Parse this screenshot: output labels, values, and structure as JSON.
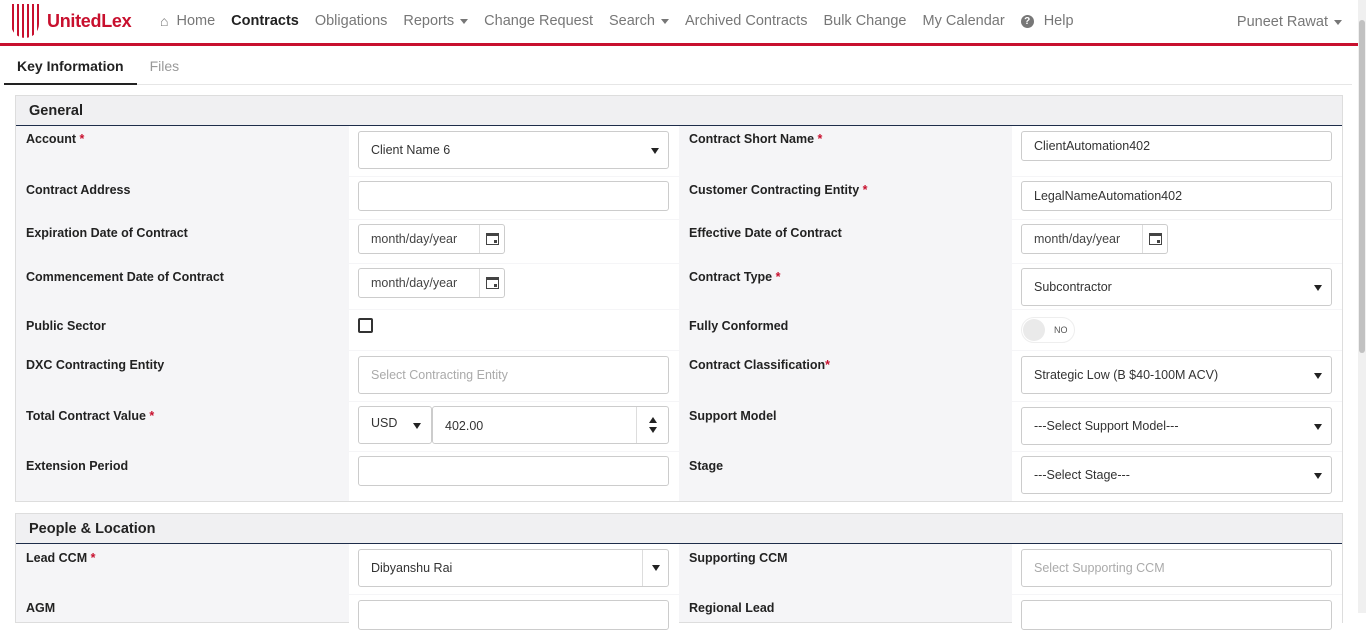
{
  "brand": {
    "name": "UnitedLex",
    "color": "#c8102e"
  },
  "nav": {
    "home": "Home",
    "contracts": "Contracts",
    "obligations": "Obligations",
    "reports": "Reports",
    "change_request": "Change Request",
    "search": "Search",
    "archived": "Archived Contracts",
    "bulk_change": "Bulk Change",
    "calendar": "My Calendar",
    "help": "Help"
  },
  "user": {
    "name": "Puneet Rawat"
  },
  "tabs": {
    "key_information": "Key Information",
    "files": "Files"
  },
  "general": {
    "title": "General",
    "account": {
      "label": "Account",
      "value": "Client Name 6"
    },
    "contract_short_name": {
      "label": "Contract Short Name",
      "value": "ClientAutomation402"
    },
    "contract_address": {
      "label": "Contract Address",
      "value": ""
    },
    "customer_contracting_entity": {
      "label": "Customer Contracting Entity",
      "value": "LegalNameAutomation402"
    },
    "expiration_date": {
      "label": "Expiration Date of Contract",
      "placeholder": "month/day/year"
    },
    "effective_date": {
      "label": "Effective Date of Contract",
      "placeholder": "month/day/year"
    },
    "commencement_date": {
      "label": "Commencement Date of Contract",
      "placeholder": "month/day/year"
    },
    "contract_type": {
      "label": "Contract Type",
      "value": "Subcontractor"
    },
    "public_sector": {
      "label": "Public Sector",
      "checked": false
    },
    "fully_conformed": {
      "label": "Fully Conformed",
      "toggle_text": "NO"
    },
    "dxc_contracting_entity": {
      "label": "DXC Contracting Entity",
      "placeholder": "Select Contracting Entity"
    },
    "contract_classification": {
      "label": "Contract Classification",
      "value": "Strategic Low (B $40-100M ACV)"
    },
    "total_contract_value": {
      "label": "Total Contract Value",
      "currency": "USD",
      "value": "402.00"
    },
    "support_model": {
      "label": "Support Model",
      "value": "---Select Support Model---"
    },
    "extension_period": {
      "label": "Extension Period",
      "value": ""
    },
    "stage": {
      "label": "Stage",
      "value": "---Select Stage---"
    }
  },
  "people": {
    "title": "People & Location",
    "lead_ccm": {
      "label": "Lead CCM",
      "value": "Dibyanshu Rai"
    },
    "supporting_ccm": {
      "label": "Supporting CCM",
      "placeholder": "Select Supporting CCM"
    },
    "agm": {
      "label": "AGM"
    },
    "regional_lead": {
      "label": "Regional Lead"
    }
  },
  "required_marker": "*"
}
